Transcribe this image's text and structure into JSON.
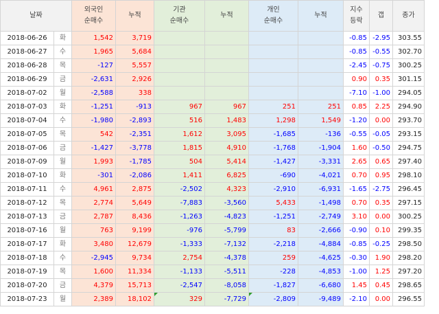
{
  "headers": {
    "date": "날짜",
    "foreign_net": [
      "외국인",
      "순매수"
    ],
    "foreign_cum": "누적",
    "inst_net": [
      "기관",
      "순매수"
    ],
    "inst_cum": "누적",
    "indiv_net": [
      "개인",
      "순매수"
    ],
    "indiv_cum": "누적",
    "index_change": [
      "지수",
      "등락"
    ],
    "gap": "갭",
    "close": "종가"
  },
  "colors": {
    "positive": "#ff0000",
    "negative": "#0000ff",
    "foreign_bg": "#fce4d6",
    "institution_bg": "#e2efda",
    "individual_bg": "#ddebf7",
    "comment_marker": "#2e9e2e"
  },
  "rows": [
    {
      "date": "2018-06-26",
      "day": "화",
      "foreign_net": "1,542",
      "foreign_cum": "3,719",
      "inst_net": "",
      "inst_cum": "",
      "indiv_net": "",
      "indiv_cum": "",
      "index_change": "-0.85",
      "gap": "-2.95",
      "close": "303.55"
    },
    {
      "date": "2018-06-27",
      "day": "수",
      "foreign_net": "1,965",
      "foreign_cum": "5,684",
      "inst_net": "",
      "inst_cum": "",
      "indiv_net": "",
      "indiv_cum": "",
      "index_change": "-0.85",
      "gap": "-0.55",
      "close": "302.70"
    },
    {
      "date": "2018-06-28",
      "day": "목",
      "foreign_net": "-127",
      "foreign_cum": "5,557",
      "inst_net": "",
      "inst_cum": "",
      "indiv_net": "",
      "indiv_cum": "",
      "index_change": "-2.45",
      "gap": "-0.75",
      "close": "300.25"
    },
    {
      "date": "2018-06-29",
      "day": "금",
      "foreign_net": "-2,631",
      "foreign_cum": "2,926",
      "inst_net": "",
      "inst_cum": "",
      "indiv_net": "",
      "indiv_cum": "",
      "index_change": "0.90",
      "gap": "0.35",
      "close": "301.15"
    },
    {
      "date": "2018-07-02",
      "day": "월",
      "foreign_net": "-2,588",
      "foreign_cum": "338",
      "inst_net": "",
      "inst_cum": "",
      "indiv_net": "",
      "indiv_cum": "",
      "index_change": "-7.10",
      "gap": "-1.00",
      "close": "294.05"
    },
    {
      "date": "2018-07-03",
      "day": "화",
      "foreign_net": "-1,251",
      "foreign_cum": "-913",
      "inst_net": "967",
      "inst_cum": "967",
      "indiv_net": "251",
      "indiv_cum": "251",
      "index_change": "0.85",
      "gap": "2.25",
      "close": "294.90"
    },
    {
      "date": "2018-07-04",
      "day": "수",
      "foreign_net": "-1,980",
      "foreign_cum": "-2,893",
      "inst_net": "516",
      "inst_cum": "1,483",
      "indiv_net": "1,298",
      "indiv_cum": "1,549",
      "index_change": "-1.20",
      "gap": "0.00",
      "close": "293.70"
    },
    {
      "date": "2018-07-05",
      "day": "목",
      "foreign_net": "542",
      "foreign_cum": "-2,351",
      "inst_net": "1,612",
      "inst_cum": "3,095",
      "indiv_net": "-1,685",
      "indiv_cum": "-136",
      "index_change": "-0.55",
      "gap": "-0.05",
      "close": "293.15"
    },
    {
      "date": "2018-07-06",
      "day": "금",
      "foreign_net": "-1,427",
      "foreign_cum": "-3,778",
      "inst_net": "1,815",
      "inst_cum": "4,910",
      "indiv_net": "-1,768",
      "indiv_cum": "-1,904",
      "index_change": "1.60",
      "gap": "-0.50",
      "close": "294.75"
    },
    {
      "date": "2018-07-09",
      "day": "월",
      "foreign_net": "1,993",
      "foreign_cum": "-1,785",
      "inst_net": "504",
      "inst_cum": "5,414",
      "indiv_net": "-1,427",
      "indiv_cum": "-3,331",
      "index_change": "2.65",
      "gap": "0.65",
      "close": "297.40"
    },
    {
      "date": "2018-07-10",
      "day": "화",
      "foreign_net": "-301",
      "foreign_cum": "-2,086",
      "inst_net": "1,411",
      "inst_cum": "6,825",
      "indiv_net": "-690",
      "indiv_cum": "-4,021",
      "index_change": "0.70",
      "gap": "0.95",
      "close": "298.10"
    },
    {
      "date": "2018-07-11",
      "day": "수",
      "foreign_net": "4,961",
      "foreign_cum": "2,875",
      "inst_net": "-2,502",
      "inst_cum": "4,323",
      "indiv_net": "-2,910",
      "indiv_cum": "-6,931",
      "index_change": "-1.65",
      "gap": "-2.75",
      "close": "296.45"
    },
    {
      "date": "2018-07-12",
      "day": "목",
      "foreign_net": "2,774",
      "foreign_cum": "5,649",
      "inst_net": "-7,883",
      "inst_cum": "-3,560",
      "indiv_net": "5,433",
      "indiv_cum": "-1,498",
      "index_change": "0.70",
      "gap": "0.35",
      "close": "297.15"
    },
    {
      "date": "2018-07-13",
      "day": "금",
      "foreign_net": "2,787",
      "foreign_cum": "8,436",
      "inst_net": "-1,263",
      "inst_cum": "-4,823",
      "indiv_net": "-1,251",
      "indiv_cum": "-2,749",
      "index_change": "3.10",
      "gap": "0.00",
      "close": "300.25"
    },
    {
      "date": "2018-07-16",
      "day": "월",
      "foreign_net": "763",
      "foreign_cum": "9,199",
      "inst_net": "-976",
      "inst_cum": "-5,799",
      "indiv_net": "83",
      "indiv_cum": "-2,666",
      "index_change": "-0.90",
      "gap": "0.10",
      "close": "299.35"
    },
    {
      "date": "2018-07-17",
      "day": "화",
      "foreign_net": "3,480",
      "foreign_cum": "12,679",
      "inst_net": "-1,333",
      "inst_cum": "-7,132",
      "indiv_net": "-2,218",
      "indiv_cum": "-4,884",
      "index_change": "-0.85",
      "gap": "-0.25",
      "close": "298.50"
    },
    {
      "date": "2018-07-18",
      "day": "수",
      "foreign_net": "-2,945",
      "foreign_cum": "9,734",
      "inst_net": "2,754",
      "inst_cum": "-4,378",
      "indiv_net": "259",
      "indiv_cum": "-4,625",
      "index_change": "-0.30",
      "gap": "1.90",
      "close": "298.20"
    },
    {
      "date": "2018-07-19",
      "day": "목",
      "foreign_net": "1,600",
      "foreign_cum": "11,334",
      "inst_net": "-1,133",
      "inst_cum": "-5,511",
      "indiv_net": "-228",
      "indiv_cum": "-4,853",
      "index_change": "-1.00",
      "gap": "1.25",
      "close": "297.20"
    },
    {
      "date": "2018-07-20",
      "day": "금",
      "foreign_net": "4,379",
      "foreign_cum": "15,713",
      "inst_net": "-2,547",
      "inst_cum": "-8,058",
      "indiv_net": "-1,827",
      "indiv_cum": "-6,680",
      "index_change": "1.45",
      "gap": "0.45",
      "close": "298.65"
    },
    {
      "date": "2018-07-23",
      "day": "월",
      "foreign_net": "2,389",
      "foreign_cum": "18,102",
      "inst_net": "329",
      "inst_cum": "-7,729",
      "indiv_net": "-2,809",
      "indiv_cum": "-9,489",
      "index_change": "-2.10",
      "gap": "0.00",
      "close": "296.55",
      "marks": [
        "inst_net",
        "indiv_net"
      ]
    }
  ]
}
